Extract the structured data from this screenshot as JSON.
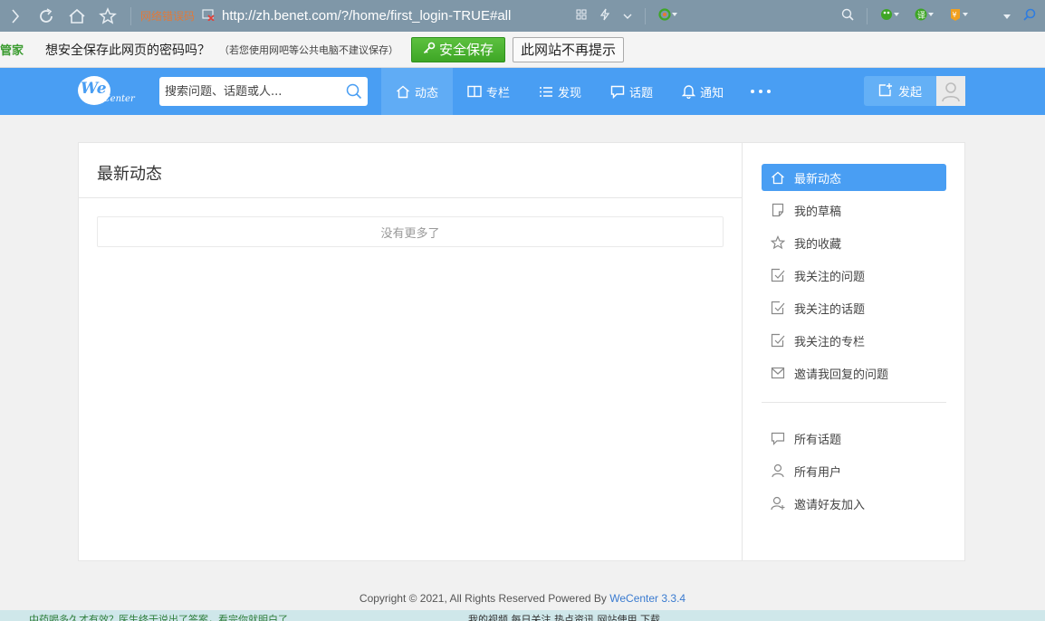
{
  "browser": {
    "site_tag": "网络错误码",
    "url": "http://zh.benet.com/?/home/first_login-TRUE#all"
  },
  "password_bar": {
    "brand": "管家",
    "question": "想安全保存此网页的密码吗？",
    "hint": "（若您使用网吧等公共电脑不建议保存）",
    "save_label": "安全保存",
    "never_label": "此网站不再提示"
  },
  "header": {
    "logo_we": "We",
    "logo_center": "Center",
    "search_placeholder": "搜索问题、话题或人...",
    "nav": [
      {
        "label": "动态"
      },
      {
        "label": "专栏"
      },
      {
        "label": "发现"
      },
      {
        "label": "话题"
      },
      {
        "label": "通知"
      }
    ],
    "publish_label": "发起"
  },
  "main": {
    "title": "最新动态",
    "no_more": "没有更多了"
  },
  "sidebar": {
    "items": [
      {
        "label": "最新动态"
      },
      {
        "label": "我的草稿"
      },
      {
        "label": "我的收藏"
      },
      {
        "label": "我关注的问题"
      },
      {
        "label": "我关注的话题"
      },
      {
        "label": "我关注的专栏"
      },
      {
        "label": "邀请我回复的问题"
      }
    ],
    "items2": [
      {
        "label": "所有话题"
      },
      {
        "label": "所有用户"
      },
      {
        "label": "邀请好友加入"
      }
    ]
  },
  "footer": {
    "copyright": "Copyright © 2021, All Rights Reserved Powered By",
    "brand": "WeCenter 3.3.4"
  },
  "status_strip": {
    "news": "中药喝多久才有效？医生终于说出了答案，看完你就明白了",
    "items": "我的视频   每日关注   热点资讯   网站使用   下载"
  },
  "colors": {
    "accent": "#499ef3",
    "chrome": "#7f97a8",
    "save_green": "#4cb332"
  }
}
